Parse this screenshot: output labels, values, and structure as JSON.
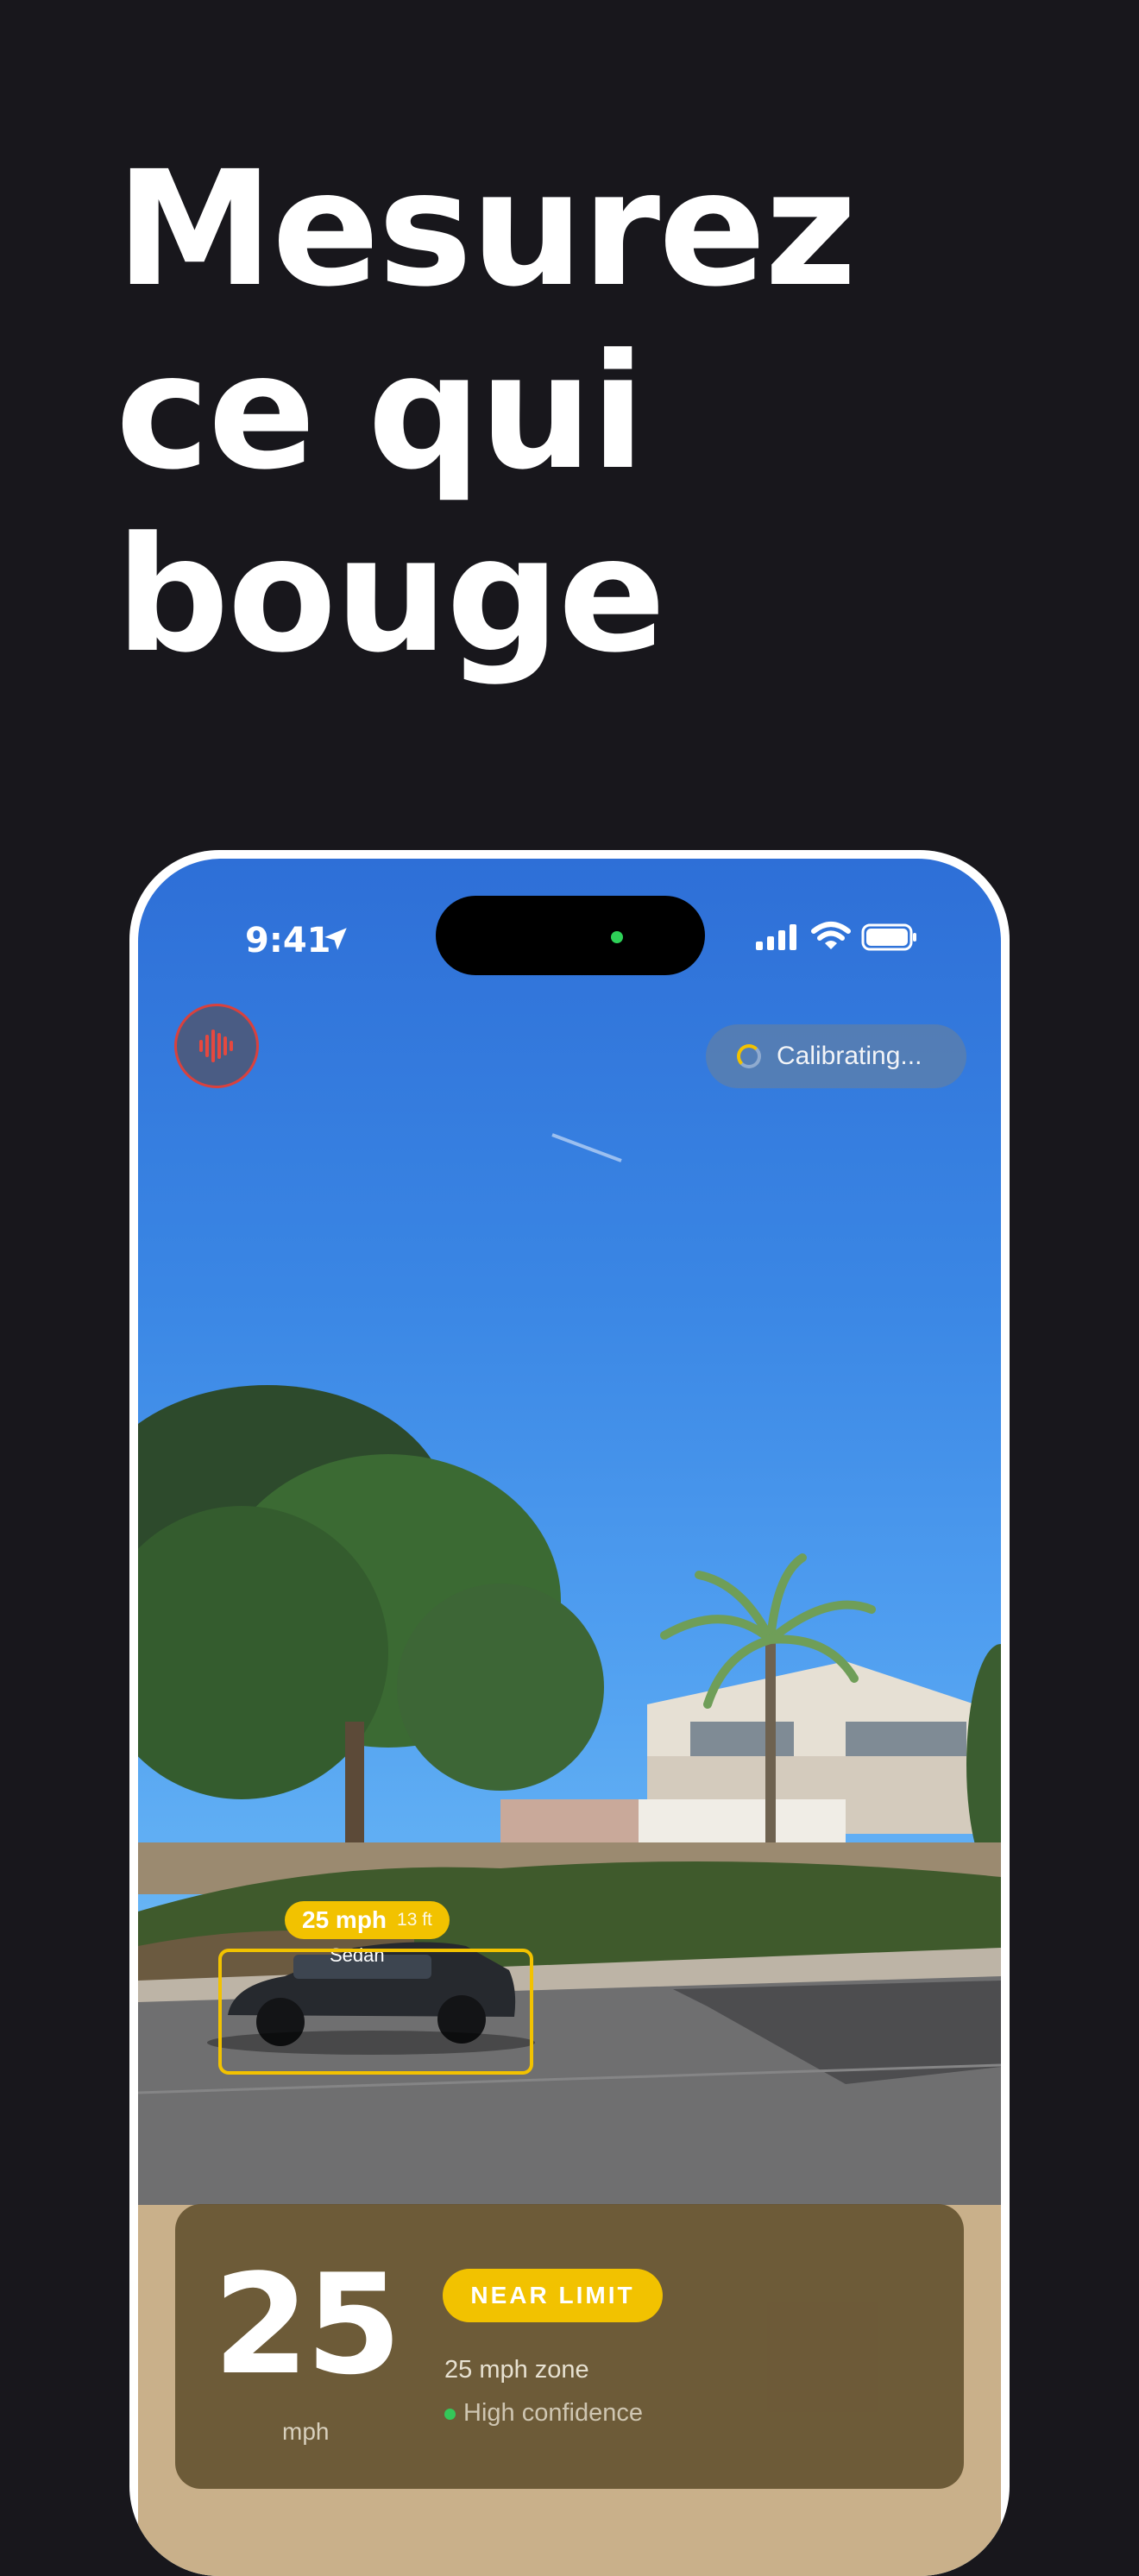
{
  "headline": {
    "lines": [
      "Mesurez",
      "ce qui",
      "bouge"
    ]
  },
  "status_bar": {
    "time": "9:41"
  },
  "top_controls": {
    "calibration_status": "Calibrating..."
  },
  "detection": {
    "speed": "25 mph",
    "distance": "13 ft",
    "label": "Sedan"
  },
  "speed_panel": {
    "speed": "25",
    "unit": "mph",
    "badge": "NEAR LIMIT",
    "zone": "25 mph zone",
    "confidence": "High confidence"
  },
  "colors": {
    "background": "#18171c",
    "accent_yellow": "#f2c200",
    "record_red": "#d9413d",
    "confidence_green": "#34c759"
  },
  "icons": [
    "location-arrow-icon",
    "cellular-signal-icon",
    "wifi-icon",
    "battery-icon",
    "audio-waveform-icon",
    "spinner-icon"
  ]
}
